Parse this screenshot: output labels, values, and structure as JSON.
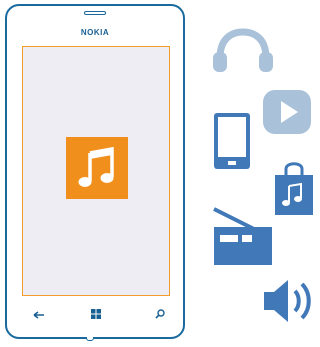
{
  "phone": {
    "brand": "NOKIA",
    "screen": {
      "tile_icon": "music-note-icon",
      "tile_color": "#f18f1d"
    },
    "nav": {
      "back_icon": "back-arrow-icon",
      "start_icon": "windows-start-icon",
      "search_icon": "search-icon"
    }
  },
  "side_icons": [
    "headphones-icon",
    "video-play-icon",
    "phone-icon",
    "music-store-bag-icon",
    "radio-icon",
    "speaker-volume-icon"
  ],
  "colors": {
    "phone_outline": "#1a6aa0",
    "screen_border": "#f39b2b",
    "icon_light_blue": "#a9c1d9",
    "icon_blue": "#4179b8",
    "accent_orange": "#f18f1d"
  }
}
